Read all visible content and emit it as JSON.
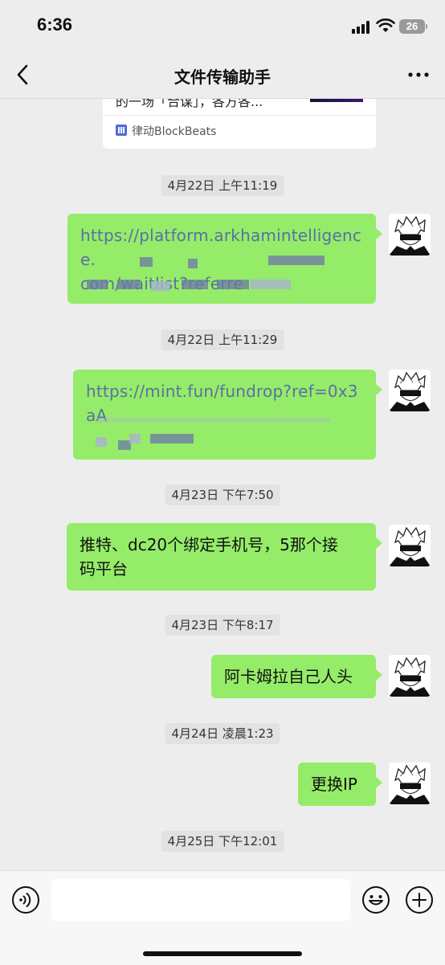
{
  "status_bar": {
    "time": "6:36",
    "battery": "26"
  },
  "nav": {
    "title": "文件传输助手"
  },
  "article_card": {
    "snippet": "的一场「合谋」，各方各...",
    "source": "律动BlockBeats"
  },
  "messages": [
    {
      "timestamp": "4月22日 上午11:19",
      "text": "https://platform.arkhamintelligence.com/waitlist?referrer=",
      "line1": "https://platform.arkhamintelligence.",
      "line2": "com/waitlist?referre"
    },
    {
      "timestamp": "4月22日 上午11:29",
      "text": "https://mint.fun/fundrop?ref=0x3aA",
      "line1": "https://mint.fun/fundrop?ref=0x3aA"
    },
    {
      "timestamp": "4月23日 下午7:50",
      "text": "推特、dc20个绑定手机号，5那个接码平台",
      "line1": "推特、dc20个绑定手机号，5那个接",
      "line2": "码平台"
    },
    {
      "timestamp": "4月23日 下午8:17",
      "text": "阿卡姆拉自己人头"
    },
    {
      "timestamp": "4月24日 凌晨1:23",
      "text": "更换IP"
    },
    {
      "timestamp": "4月25日 下午12:01"
    }
  ],
  "input": {
    "value": ""
  },
  "icons": {
    "back": "chevron-left-icon",
    "more": "ellipsis-icon",
    "voice": "voice-icon",
    "emoji": "emoji-icon",
    "add": "plus-icon"
  },
  "colors": {
    "bubble": "#95ec69",
    "background": "#ededed",
    "link": "#5b6fa6"
  }
}
